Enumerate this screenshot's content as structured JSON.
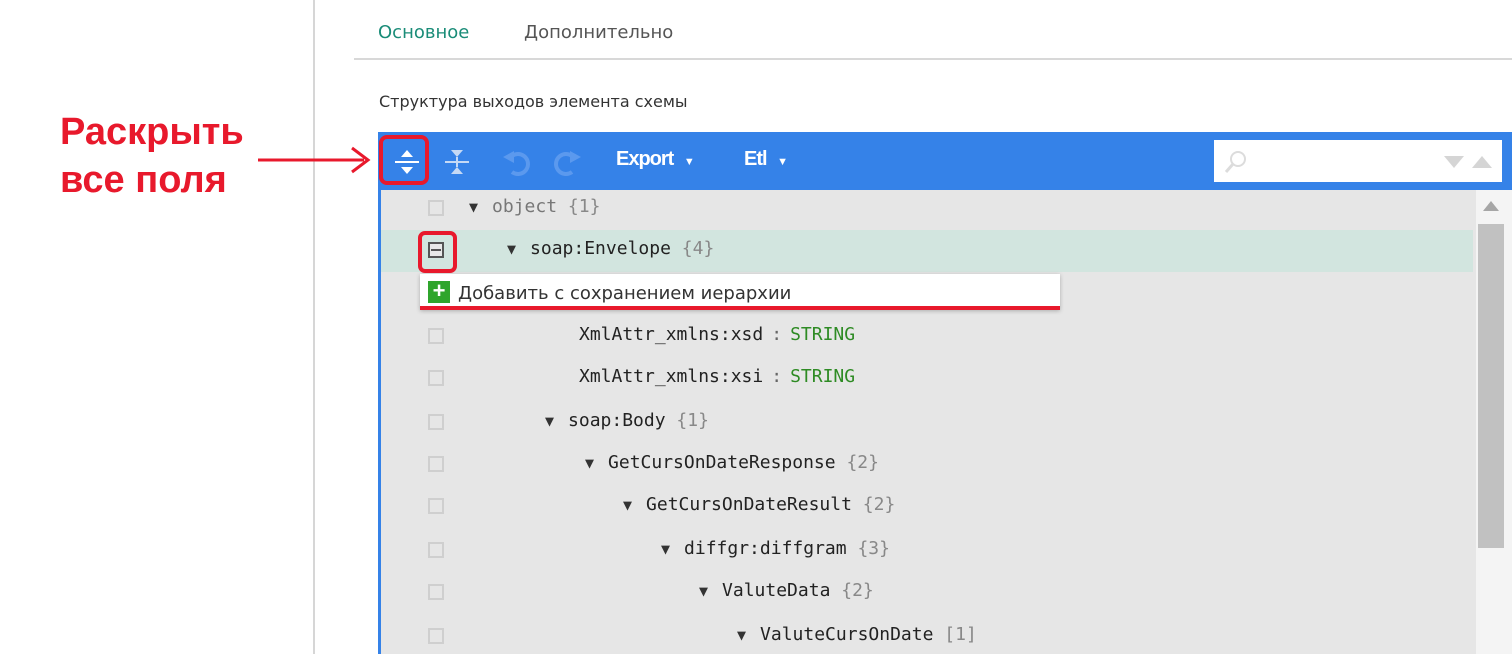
{
  "tabs": [
    {
      "label": "Основное",
      "active": true
    },
    {
      "label": "Дополнительно",
      "active": false
    }
  ],
  "section_title": "Структура выходов элемента схемы",
  "annotation": {
    "line1": "Раскрыть",
    "line2": "все поля",
    "color": "#e8192c"
  },
  "toolbar": {
    "export_label": "Export",
    "etl_label": "Etl",
    "search": {
      "value": "",
      "placeholder": ""
    },
    "color": "#3582e8"
  },
  "context_menu": {
    "add_label": "Добавить с сохранением иерархии",
    "icon": "plus-icon"
  },
  "tree": [
    {
      "name": "object",
      "count": "{1}",
      "expanded": true,
      "muted": true
    },
    {
      "name": "soap:Envelope",
      "count": "{4}",
      "expanded": true,
      "selected": true
    },
    {
      "name": "XmlAttr_xmlns:xsd",
      "type": "STRING"
    },
    {
      "name": "XmlAttr_xmlns:xsi",
      "type": "STRING"
    },
    {
      "name": "soap:Body",
      "count": "{1}",
      "expanded": true
    },
    {
      "name": "GetCursOnDateResponse",
      "count": "{2}",
      "expanded": true
    },
    {
      "name": "GetCursOnDateResult",
      "count": "{2}",
      "expanded": true
    },
    {
      "name": "diffgr:diffgram",
      "count": "{3}",
      "expanded": true
    },
    {
      "name": "ValuteData",
      "count": "{2}",
      "expanded": true
    },
    {
      "name": "ValuteCursOnDate",
      "count": "[1]",
      "expanded": true
    }
  ]
}
